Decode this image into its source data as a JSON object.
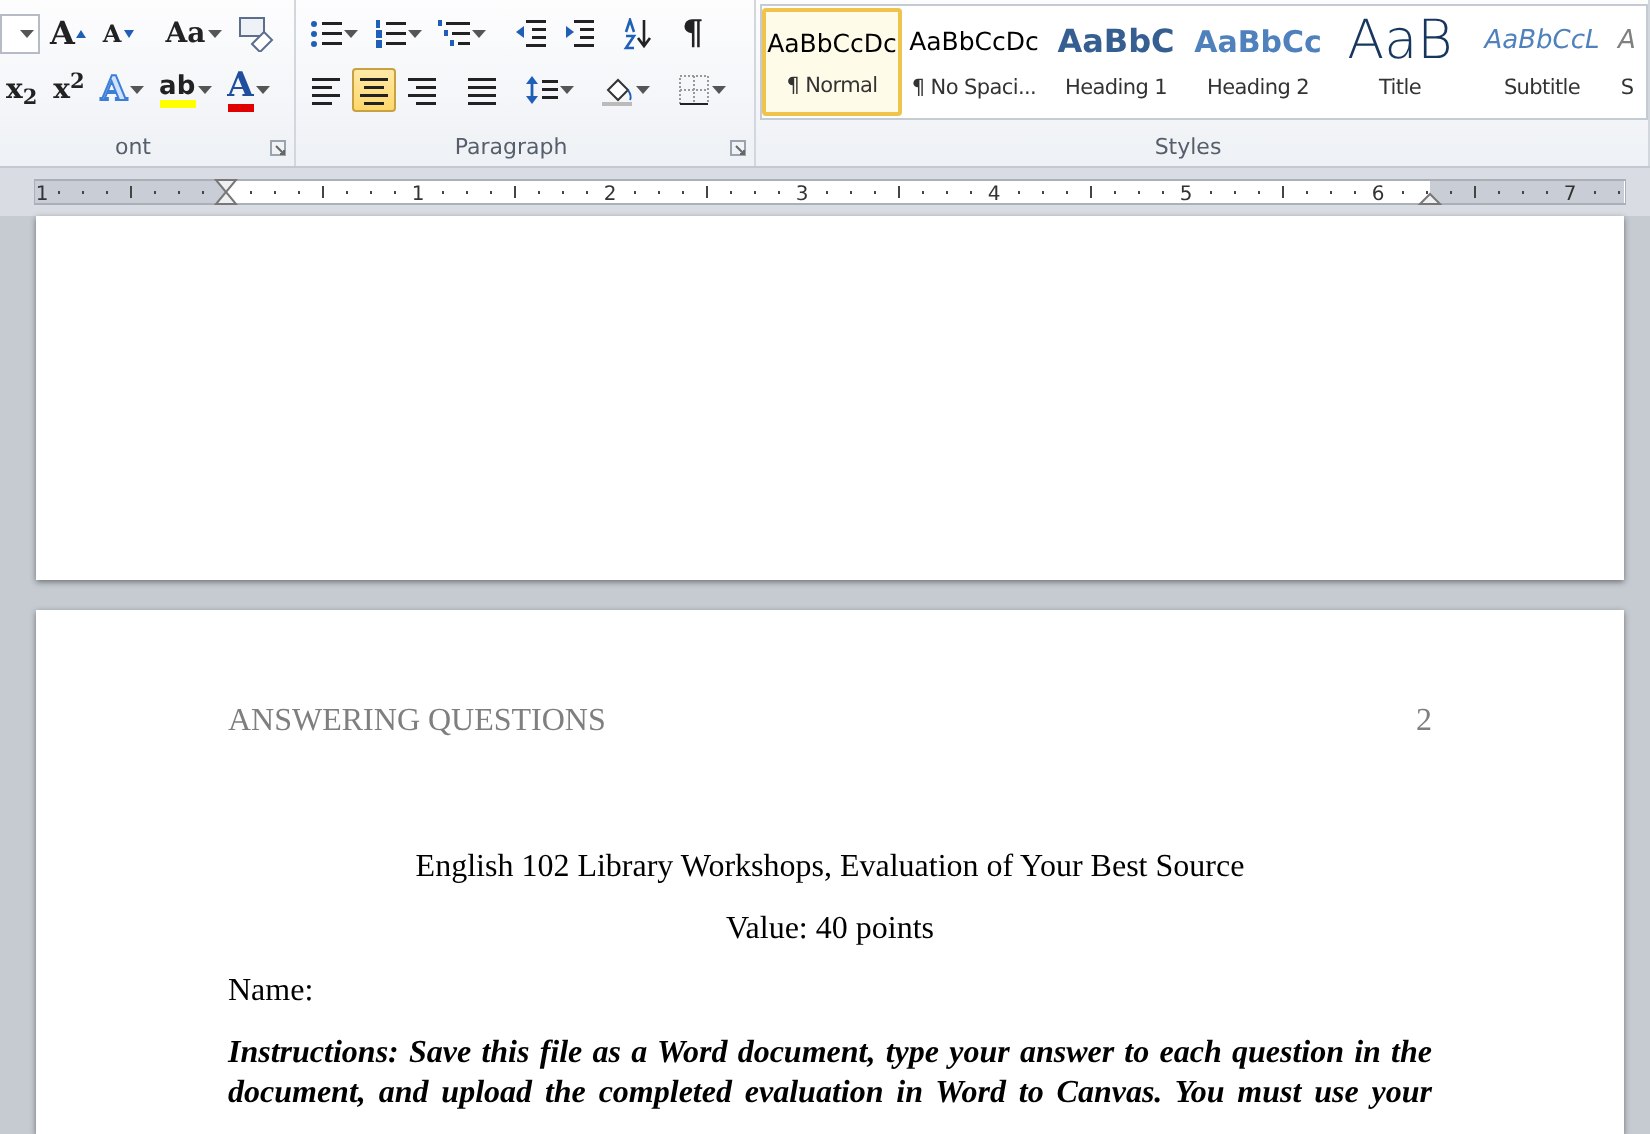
{
  "ribbon": {
    "groups": [
      {
        "kind": "font",
        "label": "ont",
        "rows": [
          [
            {
              "kind": "size-field"
            },
            {
              "kind": "grow",
              "glyph": "A"
            },
            {
              "kind": "shrink",
              "glyph": "A"
            },
            {
              "kind": "case",
              "glyph": "Aa"
            },
            {
              "kind": "clear"
            }
          ],
          [
            {
              "kind": "sub",
              "glyph": "x$_{2}$"
            },
            {
              "kind": "sup",
              "glyph": "x$^{2}$"
            },
            {
              "kind": "effects",
              "glyph": "A"
            },
            {
              "kind": "highlight",
              "glyph": "ab"
            },
            {
              "kind": "color",
              "glyph": "A"
            }
          ]
        ]
      },
      {
        "kind": "paragraph",
        "label": "Paragraph",
        "rows": [
          [
            {
              "kind": "bullets"
            },
            {
              "kind": "numbering"
            },
            {
              "kind": "multilevel"
            },
            {
              "kind": "outdent"
            },
            {
              "kind": "indent"
            },
            {
              "kind": "sort"
            },
            {
              "kind": "marks",
              "glyph": "¶"
            }
          ],
          [
            {
              "kind": "left",
              "selected": false
            },
            {
              "kind": "center",
              "selected": true
            },
            {
              "kind": "right",
              "selected": false
            },
            {
              "kind": "justify",
              "selected": false
            },
            {
              "kind": "spacing"
            },
            {
              "kind": "shading"
            },
            {
              "kind": "borders"
            }
          ]
        ]
      },
      {
        "kind": "styles",
        "label": "Styles",
        "styles": [
          {
            "kind": "normal",
            "preview": "AaBbCcDc",
            "label": "¶ Normal",
            "selected": true
          },
          {
            "kind": "normal",
            "preview": "AaBbCcDc",
            "label": "¶ No Spaci...",
            "selected": false
          },
          {
            "kind": "heading1",
            "preview": "AaBbC",
            "label": "Heading 1",
            "selected": false
          },
          {
            "kind": "heading2",
            "preview": "AaBbCc",
            "label": "Heading 2",
            "selected": false
          },
          {
            "kind": "title",
            "preview": "AaB",
            "label": "Title",
            "selected": false
          },
          {
            "kind": "subtitle",
            "preview": "AaBbCcL",
            "label": "Subtitle",
            "selected": false
          },
          {
            "kind": "subtle",
            "preview": "A",
            "label": "S",
            "selected": false
          }
        ]
      }
    ]
  },
  "ruler": {
    "numbers": [
      "1",
      "1",
      "2",
      "3",
      "4",
      "5",
      "6",
      "7"
    ]
  },
  "document": {
    "header": {
      "title": "ANSWERING QUESTIONS",
      "page_number": "2"
    },
    "paragraphs": [
      {
        "kind": "center",
        "text": "English 102 Library Workshops, Evaluation of Your Best Source"
      },
      {
        "kind": "center",
        "text": "Value: 40 points"
      },
      {
        "kind": "plain",
        "text": "Name:"
      },
      {
        "kind": "instructions",
        "text": "Instructions: Save this file as a Word document, type your answer to each question in the document, and upload the completed evaluation in Word to Canvas. You must use your"
      }
    ]
  }
}
